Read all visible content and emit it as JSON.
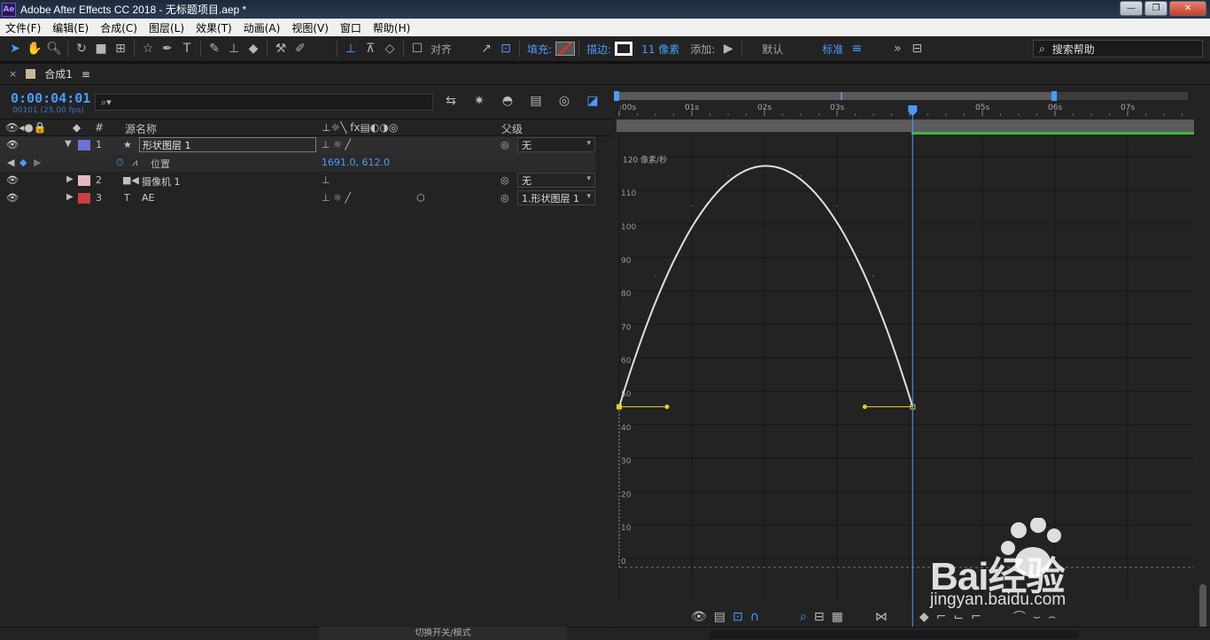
{
  "window": {
    "app_icon": "Ae",
    "title": "Adobe After Effects CC 2018 - 无标题项目.aep *",
    "buttons": [
      "—",
      "❐",
      "✕"
    ]
  },
  "menu": [
    "文件(F)",
    "编辑(E)",
    "合成(C)",
    "图层(L)",
    "效果(T)",
    "动画(A)",
    "视图(V)",
    "窗口",
    "帮助(H)"
  ],
  "toolbar": {
    "snap_label": "对齐",
    "fill_label": "填充:",
    "stroke_label": "描边:",
    "stroke_width": "11 像素",
    "add_label": "添加:",
    "default_label": "默认",
    "standard_label": "标准",
    "search_help": "搜索帮助",
    "colors": {
      "accent": "#4a9bff",
      "fill_swatch": "#d33333"
    }
  },
  "comp_tab": {
    "close": "×",
    "label": "合成1",
    "menu": "≡"
  },
  "time": {
    "timecode": "0:00:04:01",
    "fps": "00101 (25.00 fps)",
    "search_placeholder": "⌕▾"
  },
  "columns": {
    "number": "#",
    "source_name": "源名称",
    "parent": "父级"
  },
  "layers": [
    {
      "num": "1",
      "name": "形状图层 1",
      "color": "#6b72d6",
      "icon": "★",
      "parent": "无",
      "expanded": true
    },
    {
      "num": "2",
      "name": "摄像机 1",
      "color": "#e8b8c0",
      "icon": "■◀",
      "parent": "无"
    },
    {
      "num": "3",
      "name": "AE",
      "color": "#c84040",
      "icon": "T",
      "parent": "1.形状图层 1"
    }
  ],
  "property": {
    "name": "位置",
    "value": "1691.0, 612.0"
  },
  "timeline": {
    "ticks": [
      ":00s",
      "01s",
      "02s",
      "03s",
      "04s",
      "05s",
      "06s",
      "07s"
    ],
    "unit_label": "120 像素/秒",
    "y_labels": [
      "110",
      "100",
      "90",
      "80",
      "70",
      "60",
      "50",
      "40",
      "30",
      "20",
      "10",
      "0"
    ]
  },
  "chart_data": {
    "type": "line",
    "title": "",
    "xlabel": "",
    "ylabel": "像素/秒",
    "x": [
      0,
      0.5,
      1,
      1.5,
      2,
      2.5,
      3,
      3.5,
      4.04
    ],
    "series": [
      {
        "values": [
          48,
          87,
          108,
          117,
          120,
          117,
          108,
          87,
          48
        ]
      }
    ],
    "ylim": [
      0,
      120
    ],
    "xlim": [
      0,
      7.5
    ],
    "keyframes": [
      {
        "x": 0,
        "y": 48
      },
      {
        "x": 4.04,
        "y": 48
      }
    ],
    "current_time": 4.04,
    "grid": true
  },
  "bottom": {
    "toggle_label": "切换开关/模式"
  },
  "watermark": {
    "text": "Bai经验",
    "url": "jingyan.baidu.com"
  }
}
